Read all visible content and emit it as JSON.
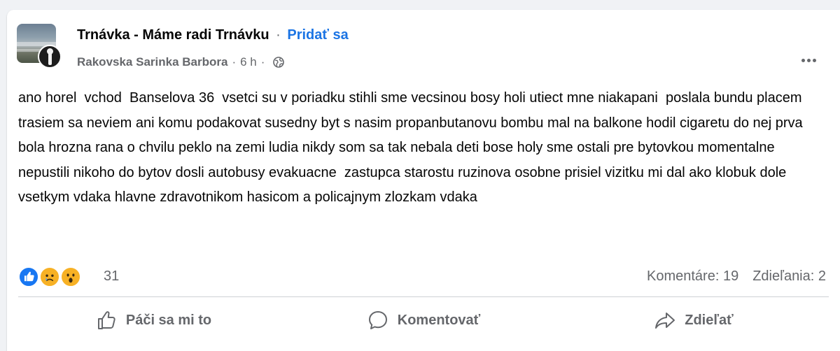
{
  "post": {
    "group_name": "Trnávka - Máme radi Trnávku",
    "title_separator": "·",
    "join_label": "Pridať sa",
    "author": "Rakovska Sarinka Barbora",
    "meta_separator": "·",
    "time": "6 h",
    "audience_icon": "globe-icon",
    "more_icon": "more-options-icon",
    "text": "ano horel  vchod  Banselova 36  vsetci su v poriadku stihli sme vecsinou bosy holi utiect mne niakapani  poslala bundu placem trasiem sa neviem ani komu podakovat susedny byt s nasim propanbutanovu bombu mal na balkone hodil cigaretu do nej prva bola hrozna rana o chvilu peklo na zemi ludia nikdy som sa tak nebala deti bose holy sme ostali pre bytovkou momentalne nepustili nikoho do bytov dosli autobusy evakuacne  zastupca starostu ruzinova osobne prisiel vizitku mi dal ako klobuk dole vsetkym vdaka hlavne zdravotnikom hasicom a policajnym zlozkam vdaka"
  },
  "reactions": {
    "icons": [
      "like-icon",
      "sad-icon",
      "wow-icon"
    ],
    "count": "31",
    "comments": "Komentáre: 19",
    "shares": "Zdieľania: 2"
  },
  "actions": {
    "like_label": "Páči sa mi to",
    "comment_label": "Komentovať",
    "share_label": "Zdieľať"
  },
  "colors": {
    "accent": "#1b74e4",
    "muted": "#65676b",
    "like": "#1877f2",
    "emoji": "#f7b125"
  }
}
